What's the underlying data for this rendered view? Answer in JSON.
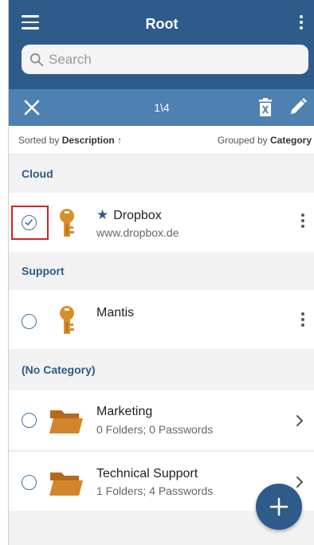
{
  "header": {
    "title": "Root"
  },
  "search": {
    "placeholder": "Search"
  },
  "selection": {
    "count": "1\\4"
  },
  "sortbar": {
    "sorted_prefix": "Sorted by",
    "sorted_field": "Description",
    "sorted_arrow": "↑",
    "grouped_prefix": "Grouped by",
    "grouped_field": "Category"
  },
  "sections": {
    "cloud": {
      "title": "Cloud",
      "items": [
        {
          "name": "Dropbox",
          "sub": "www.dropbox.de",
          "favorite": true,
          "selected": true,
          "icon": "key-icon"
        }
      ]
    },
    "support": {
      "title": "Support",
      "items": [
        {
          "name": "Mantis",
          "selected": false,
          "icon": "key-icon"
        }
      ]
    },
    "no_category": {
      "title": "(No Category)",
      "items": [
        {
          "name": "Marketing",
          "sub": "0 Folders; 0 Passwords",
          "icon": "folder-icon"
        },
        {
          "name": "Technical Support",
          "sub": "1 Folders; 4 Passwords",
          "icon": "folder-icon"
        }
      ]
    }
  },
  "colors": {
    "header": "#2f5b8a",
    "selection_bar": "#4f80b2",
    "accent": "#2f5b8a",
    "key": "#d88f2a",
    "folder": "#c9781c",
    "highlight": "#d42222"
  }
}
